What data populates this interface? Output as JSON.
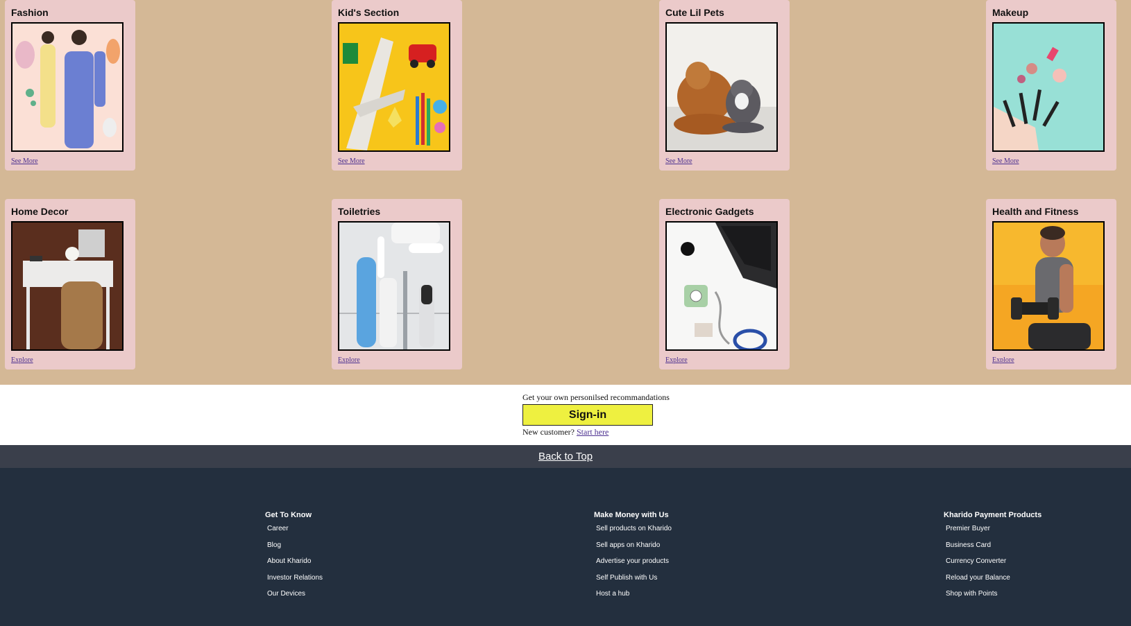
{
  "categories_top": [
    {
      "title": "Fashion",
      "link": "See More"
    },
    {
      "title": "Kid's Section",
      "link": "See More"
    },
    {
      "title": "Cute Lil Pets",
      "link": "See More"
    },
    {
      "title": "Makeup",
      "link": "See More"
    }
  ],
  "categories_bottom": [
    {
      "title": "Home Decor",
      "link": "Explore"
    },
    {
      "title": "Toiletries",
      "link": "Explore"
    },
    {
      "title": "Electronic Gadgets",
      "link": "Explore"
    },
    {
      "title": "Health and Fitness",
      "link": "Explore"
    }
  ],
  "signin": {
    "prompt": "Get your own personilsed recommandations",
    "button": "Sign-in",
    "new_customer": "New customer?",
    "start_here": "Start here"
  },
  "back_to_top": "Back to Top",
  "footer": {
    "columns": [
      {
        "heading": "Get To Know",
        "items": [
          "Career",
          "Blog",
          "About Kharido",
          "Investor Relations",
          "Our Devices"
        ]
      },
      {
        "heading": "Make Money with Us",
        "items": [
          "Sell products on Kharido",
          "Sell apps on Kharido",
          "Advertise your products",
          "Self Publish with Us",
          "Host a hub"
        ]
      },
      {
        "heading": "Kharido Payment Products",
        "items": [
          "Premier Buyer",
          "Business Card",
          "Currency Converter",
          "Reload your Balance",
          "Shop with Points"
        ]
      }
    ]
  }
}
